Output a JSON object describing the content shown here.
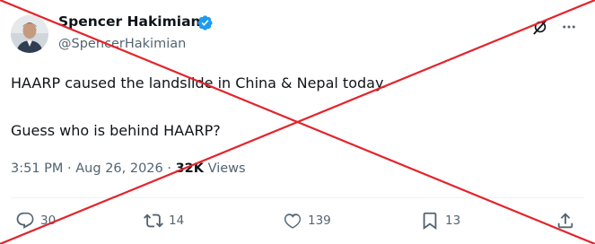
{
  "author": {
    "display_name": "Spencer Hakimian",
    "handle": "@SpencerHakimian",
    "verified": true
  },
  "tweet": {
    "line1": "HAARP caused the landslide in China & Nepal today.",
    "line2": "Guess who is behind HAARP?"
  },
  "meta": {
    "time": "3:51 PM",
    "separator1": " · ",
    "date": "Aug 26, 2026",
    "separator2": " · ",
    "views_count": "32K",
    "views_label": " Views"
  },
  "actions": {
    "replies": "30",
    "reposts": "14",
    "likes": "139",
    "bookmarks": "13"
  },
  "icons": {
    "verified": "verified-badge-icon",
    "grok": "grok-icon",
    "more": "more-icon",
    "reply": "reply-icon",
    "repost": "repost-icon",
    "like": "heart-icon",
    "bookmark": "bookmark-icon",
    "share": "share-icon"
  },
  "colors": {
    "verified_blue": "#1d9bf0",
    "cross_red": "#e3242b",
    "secondary_text": "#536471"
  }
}
